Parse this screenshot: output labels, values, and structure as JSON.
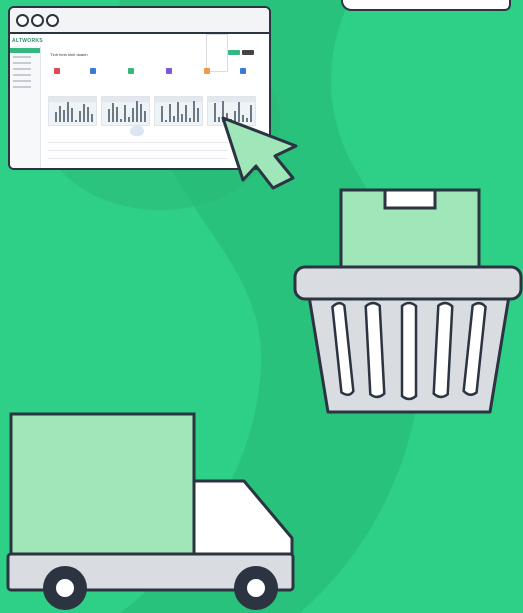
{
  "window": {
    "controls": [
      "window-dot-icon",
      "window-dot-icon",
      "window-dot-icon"
    ],
    "screenshot": {
      "logo": "ALTWORKS",
      "title": "Tình hình kinh doanh"
    }
  },
  "colors": {
    "background": "#2ecf86",
    "outline": "#2b3440",
    "light_green": "#9fe6b9",
    "basket_gray": "#d9dde2",
    "window_bg": "#ffffff",
    "titlebar": "#f2f4f6"
  },
  "icons": {
    "cursor": "cursor-arrow-icon",
    "box": "box-icon",
    "basket": "shopping-basket-icon",
    "truck": "delivery-truck-icon"
  }
}
